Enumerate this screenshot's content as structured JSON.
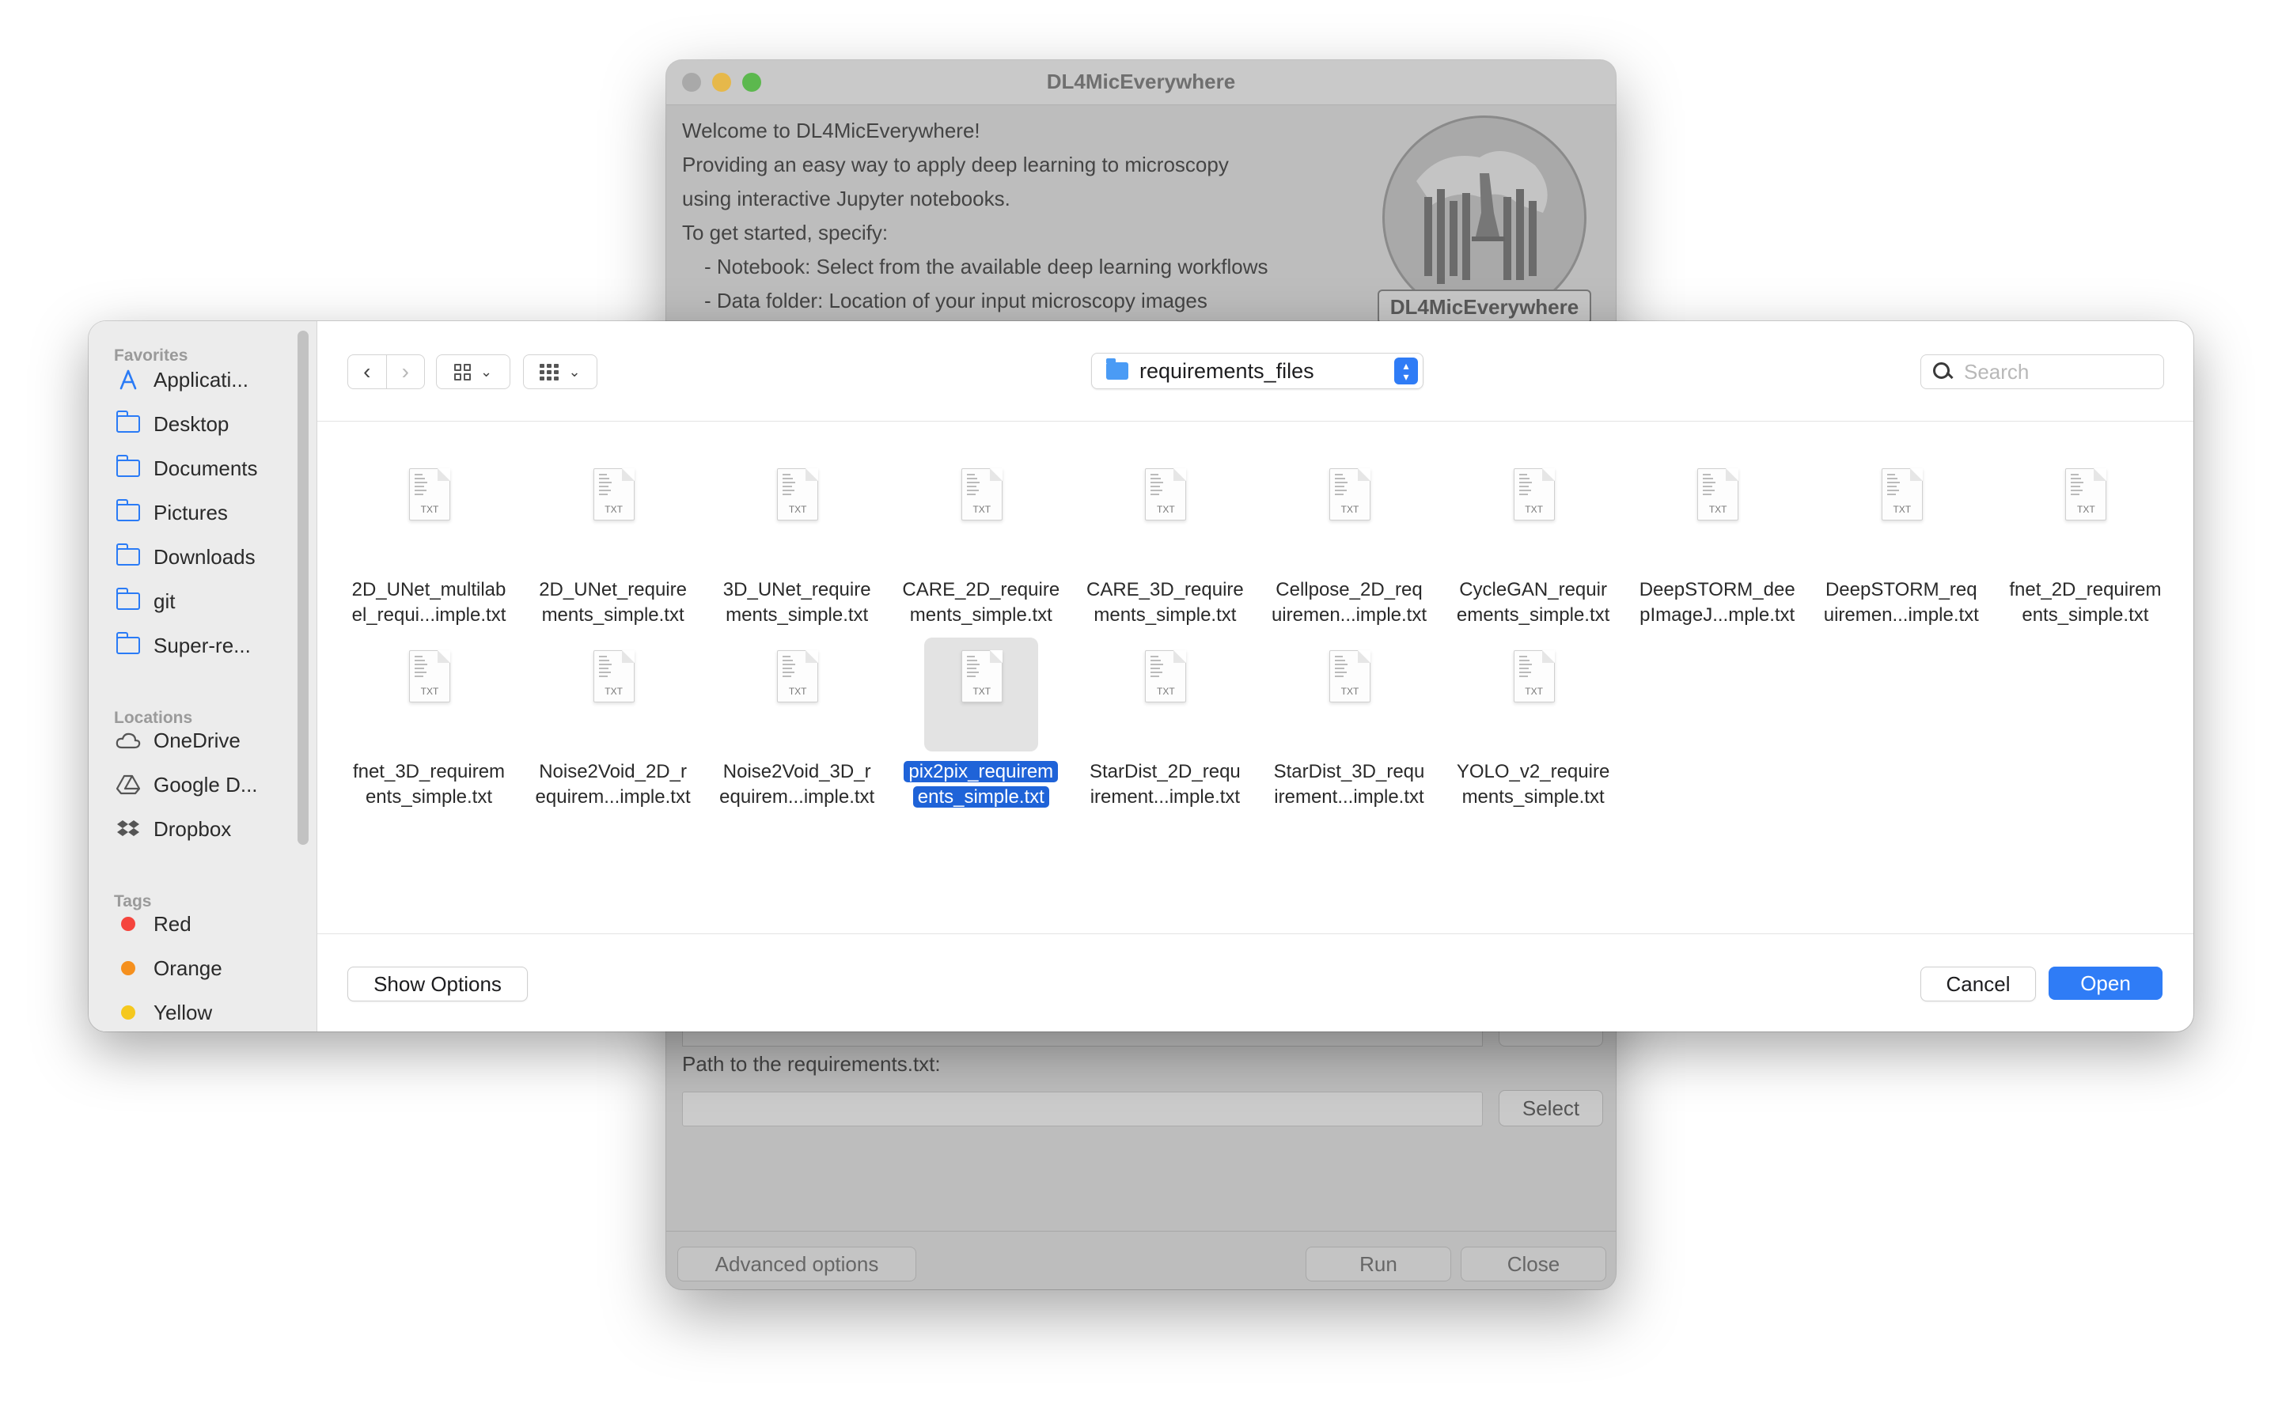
{
  "app": {
    "title": "DL4MicEverywhere",
    "welcome_lines": [
      "Welcome to DL4MicEverywhere!",
      "Providing an easy way to apply deep learning to microscopy",
      "using interactive Jupyter notebooks.",
      "To get started, specify:",
      "- Notebook: Select from the available deep learning workflows",
      "- Data folder: Location of your input microscopy images"
    ],
    "logo_text": "DL4MicEverywhere",
    "req_label": "Path to the requirements.txt:",
    "req_value": "",
    "select_label": "Select",
    "advanced_label": "Advanced options",
    "run_label": "Run",
    "close_label": "Close"
  },
  "dialog": {
    "sidebar": {
      "favorites_header": "Favorites",
      "favorites": [
        {
          "label": "Applicati...",
          "icon": "applications-icon"
        },
        {
          "label": "Desktop",
          "icon": "folder-icon"
        },
        {
          "label": "Documents",
          "icon": "folder-icon"
        },
        {
          "label": "Pictures",
          "icon": "folder-icon"
        },
        {
          "label": "Downloads",
          "icon": "folder-icon"
        },
        {
          "label": "git",
          "icon": "folder-icon"
        },
        {
          "label": "Super-re...",
          "icon": "folder-icon"
        }
      ],
      "locations_header": "Locations",
      "locations": [
        {
          "label": "OneDrive",
          "icon": "cloud-icon"
        },
        {
          "label": "Google D...",
          "icon": "google-drive-icon"
        },
        {
          "label": "Dropbox",
          "icon": "dropbox-icon"
        }
      ],
      "tags_header": "Tags",
      "tags": [
        {
          "label": "Red",
          "color": "#f5453d"
        },
        {
          "label": "Orange",
          "color": "#f5901e"
        },
        {
          "label": "Yellow",
          "color": "#f5c81e"
        }
      ]
    },
    "path": "requirements_files",
    "search_placeholder": "Search",
    "file_type": "TXT",
    "files": [
      {
        "line1": "2D_UNet_multilab",
        "line2": "el_requi...imple.txt",
        "selected": false
      },
      {
        "line1": "2D_UNet_require",
        "line2": "ments_simple.txt",
        "selected": false
      },
      {
        "line1": "3D_UNet_require",
        "line2": "ments_simple.txt",
        "selected": false
      },
      {
        "line1": "CARE_2D_require",
        "line2": "ments_simple.txt",
        "selected": false
      },
      {
        "line1": "CARE_3D_require",
        "line2": "ments_simple.txt",
        "selected": false
      },
      {
        "line1": "Cellpose_2D_req",
        "line2": "uiremen...imple.txt",
        "selected": false
      },
      {
        "line1": "CycleGAN_requir",
        "line2": "ements_simple.txt",
        "selected": false
      },
      {
        "line1": "DeepSTORM_dee",
        "line2": "pImageJ...mple.txt",
        "selected": false
      },
      {
        "line1": "DeepSTORM_req",
        "line2": "uiremen...imple.txt",
        "selected": false
      },
      {
        "line1": "fnet_2D_requirem",
        "line2": "ents_simple.txt",
        "selected": false
      },
      {
        "line1": "fnet_3D_requirem",
        "line2": "ents_simple.txt",
        "selected": false
      },
      {
        "line1": "Noise2Void_2D_r",
        "line2": "equirem...imple.txt",
        "selected": false
      },
      {
        "line1": "Noise2Void_3D_r",
        "line2": "equirem...imple.txt",
        "selected": false
      },
      {
        "line1": "pix2pix_requirem",
        "line2": "ents_simple.txt",
        "selected": true
      },
      {
        "line1": "StarDist_2D_requ",
        "line2": "irement...imple.txt",
        "selected": false
      },
      {
        "line1": "StarDist_3D_requ",
        "line2": "irement...imple.txt",
        "selected": false
      },
      {
        "line1": "YOLO_v2_require",
        "line2": "ments_simple.txt",
        "selected": false
      }
    ],
    "show_options_label": "Show Options",
    "cancel_label": "Cancel",
    "open_label": "Open"
  }
}
